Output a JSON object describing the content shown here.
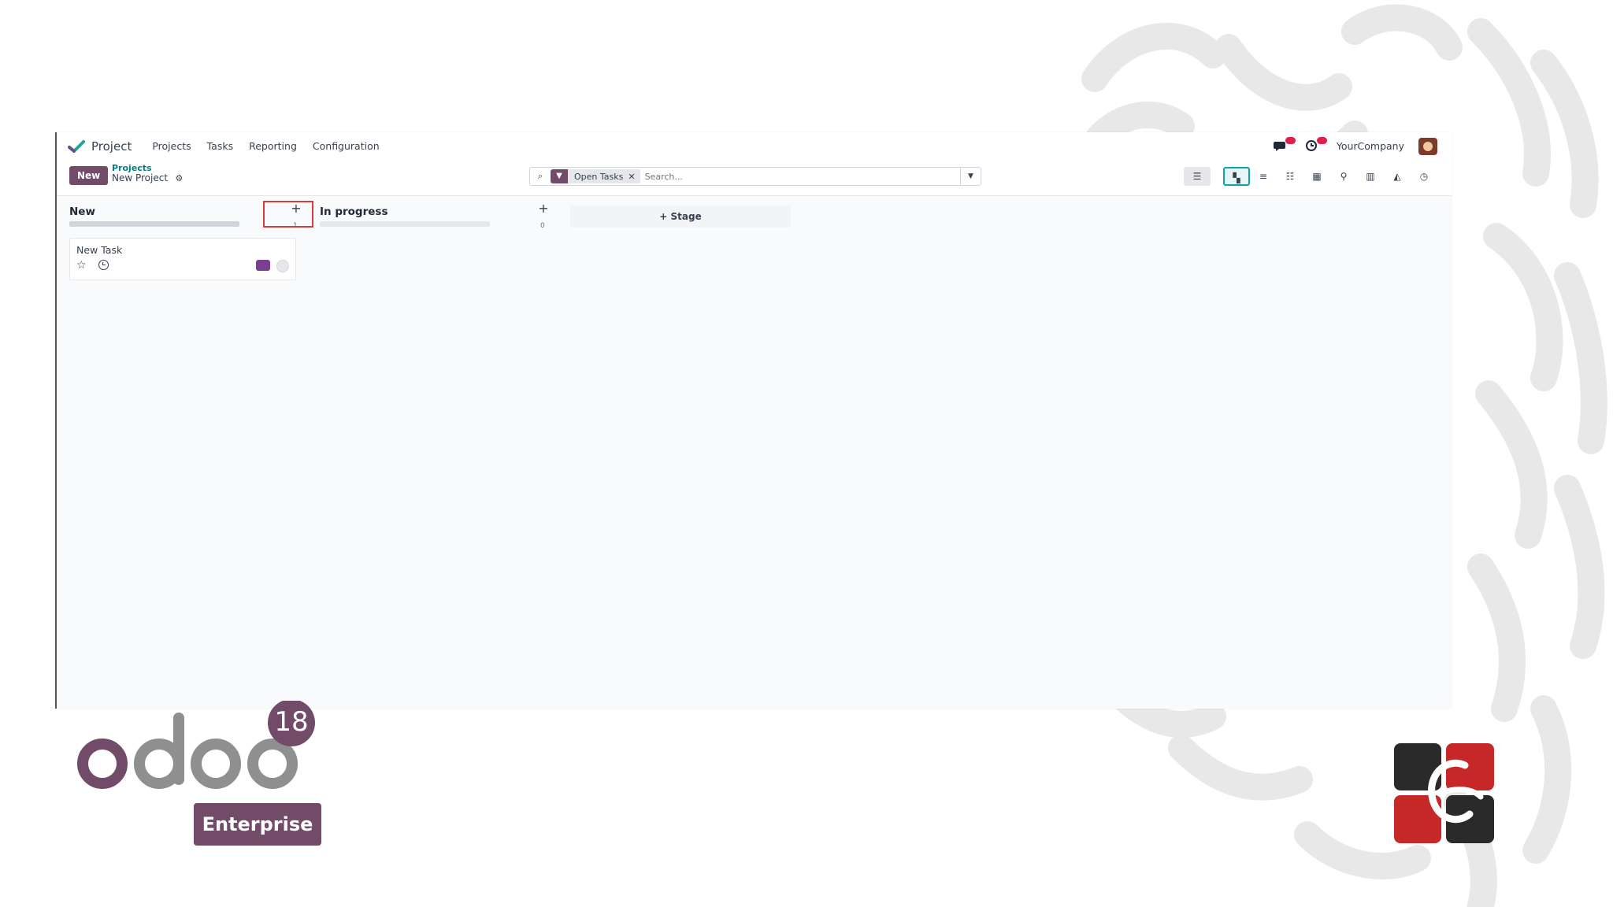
{
  "topbar": {
    "app_name": "Project",
    "menu": [
      "Projects",
      "Tasks",
      "Reporting",
      "Configuration"
    ],
    "company": "YourCompany"
  },
  "control": {
    "new_button": "New",
    "breadcrumb_parent": "Projects",
    "breadcrumb_current": "New Project"
  },
  "search": {
    "facet_label": "Open Tasks",
    "placeholder": "Search..."
  },
  "kanban": {
    "columns": [
      {
        "title": "New",
        "count": "1"
      },
      {
        "title": "In progress",
        "count": "0"
      }
    ],
    "card": {
      "title": "New Task"
    },
    "add_stage": "Stage"
  },
  "branding": {
    "version": "18",
    "edition": "Enterprise",
    "brand_color": "#714b67",
    "accent_teal": "#017e84"
  }
}
